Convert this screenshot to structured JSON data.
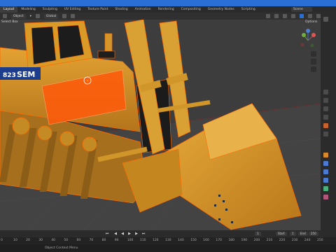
{
  "tabs": [
    "Layout",
    "Modeling",
    "Sculpting",
    "UV Editing",
    "Texture Paint",
    "Shading",
    "Animation",
    "Rendering",
    "Compositing",
    "Geometry Nodes",
    "Scripting"
  ],
  "scene_name": "Scene",
  "viewport": {
    "mode": "Object",
    "transform": "Global",
    "select_box": "Select Box",
    "options": "Options"
  },
  "machine_decals": {
    "number": "823",
    "brand": "SEM"
  },
  "timeline": {
    "start_label": "Start",
    "start_value": "1",
    "end_label": "End",
    "end_value": "250",
    "current_frame": "1",
    "ticks": [
      "0",
      "10",
      "20",
      "30",
      "40",
      "50",
      "60",
      "70",
      "80",
      "90",
      "100",
      "110",
      "120",
      "130",
      "140",
      "150",
      "160",
      "170",
      "180",
      "190",
      "200",
      "210",
      "220",
      "230",
      "240",
      "250"
    ]
  },
  "status": {
    "left_text": "Object Context Menu"
  },
  "colors": {
    "accent": "#2a6fd6",
    "machine_yellow": "#d79a26",
    "selection_orange": "#ff6a00",
    "viewport_bg": "#3f3f3f"
  }
}
